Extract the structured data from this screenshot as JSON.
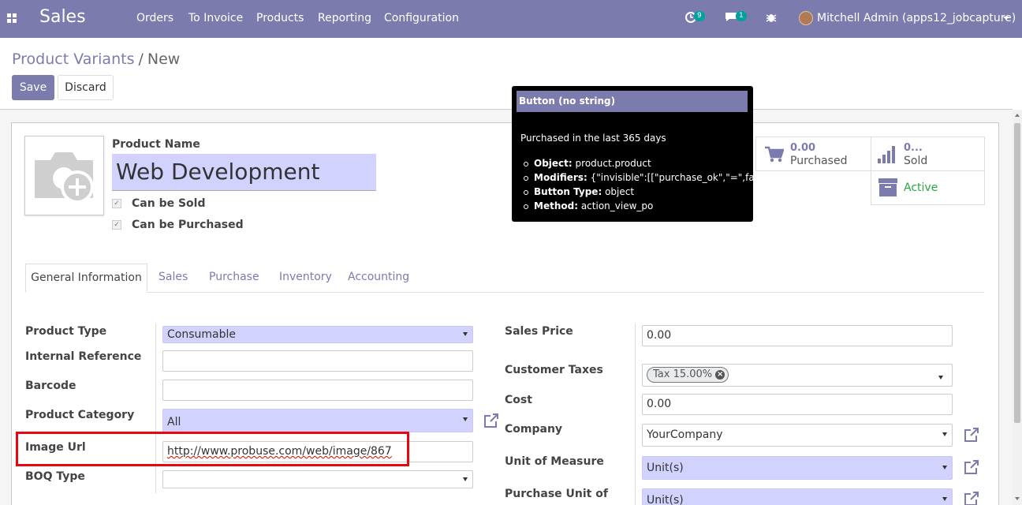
{
  "navbar": {
    "brand": "Sales",
    "menu": [
      "Orders",
      "To Invoice",
      "Products",
      "Reporting",
      "Configuration"
    ],
    "activity_badge": "9",
    "messages_badge": "1",
    "user": "Mitchell Admin (apps12_jobcapture)"
  },
  "breadcrumb": {
    "parent": "Product Variants",
    "separator": "/",
    "current": "New"
  },
  "buttons": {
    "save": "Save",
    "discard": "Discard"
  },
  "product": {
    "name_label": "Product Name",
    "name": "Web Development",
    "can_be_sold": "Can be Sold",
    "can_be_purchased": "Can be Purchased"
  },
  "smart_buttons": {
    "purchased_value": "0.00",
    "purchased_label": "Purchased",
    "sold_value": "0...",
    "sold_label": "Sold",
    "active_label": "Active"
  },
  "tooltip": {
    "title": "Button (no string)",
    "description": "Purchased in the last 365 days",
    "items": [
      {
        "key": "Object:",
        "value": "product.product"
      },
      {
        "key": "Modifiers:",
        "value": "{\"invisible\":[[\"purchase_ok\",\"=\",false]]}"
      },
      {
        "key": "Button Type:",
        "value": "object"
      },
      {
        "key": "Method:",
        "value": "action_view_po"
      }
    ]
  },
  "tabs": [
    "General Information",
    "Sales",
    "Purchase",
    "Inventory",
    "Accounting"
  ],
  "left_fields": {
    "product_type_label": "Product Type",
    "product_type": "Consumable",
    "internal_reference_label": "Internal Reference",
    "internal_reference": "",
    "barcode_label": "Barcode",
    "barcode": "",
    "product_category_label": "Product Category",
    "product_category": "All",
    "image_url_label": "Image Url",
    "image_url": "http://www.probuse.com/web/image/867",
    "boq_type_label": "BOQ Type",
    "boq_type": ""
  },
  "right_fields": {
    "sales_price_label": "Sales Price",
    "sales_price": "0.00",
    "customer_taxes_label": "Customer Taxes",
    "customer_tax_tag": "Tax 15.00%",
    "cost_label": "Cost",
    "cost": "0.00",
    "company_label": "Company",
    "company": "YourCompany",
    "uom_label": "Unit of Measure",
    "uom": "Unit(s)",
    "purchase_uom_label": "Purchase Unit of",
    "purchase_uom": "Unit(s)"
  },
  "colors": {
    "brand": "#7c7bad",
    "required_field": "#d2d2ff",
    "highlight_box": "#e8070f",
    "active_status": "#28a745"
  }
}
